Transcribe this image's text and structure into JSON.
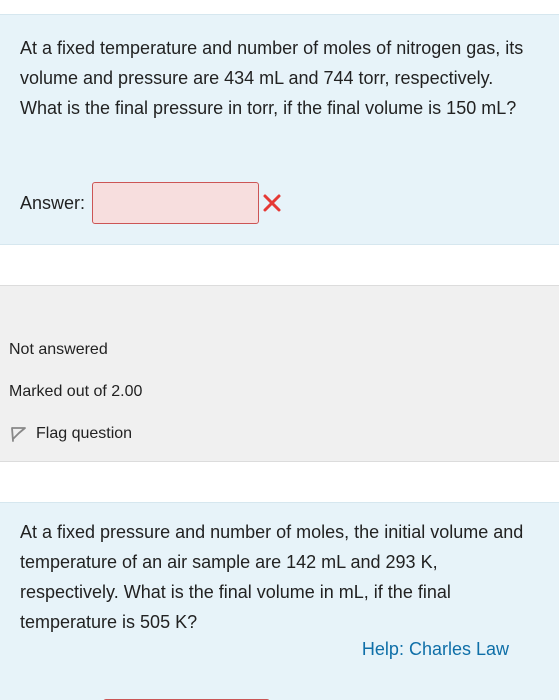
{
  "question1": {
    "text": "At a fixed temperature and number of moles of nitrogen gas, its volume and pressure are 434 mL and 744 torr, respectively. What is the final pressure in torr, if the final volume is 150 mL?",
    "answer_label": "Answer:",
    "answer_value": "",
    "answer_status_icon": "cross-icon",
    "status_color": "#e53935"
  },
  "question_info": {
    "state": "Not answered",
    "grade": "Marked out of 2.00",
    "flag_label": "Flag question",
    "flag_icon": "flag-icon"
  },
  "question2": {
    "text": "At a fixed pressure and number of moles, the initial volume and temperature of an air sample are 142 mL and 293 K, respectively. What is the final volume in mL, if the final temperature is 505 K?",
    "help_link": "Help: Charles Law",
    "link_color": "#0f6fa8"
  }
}
